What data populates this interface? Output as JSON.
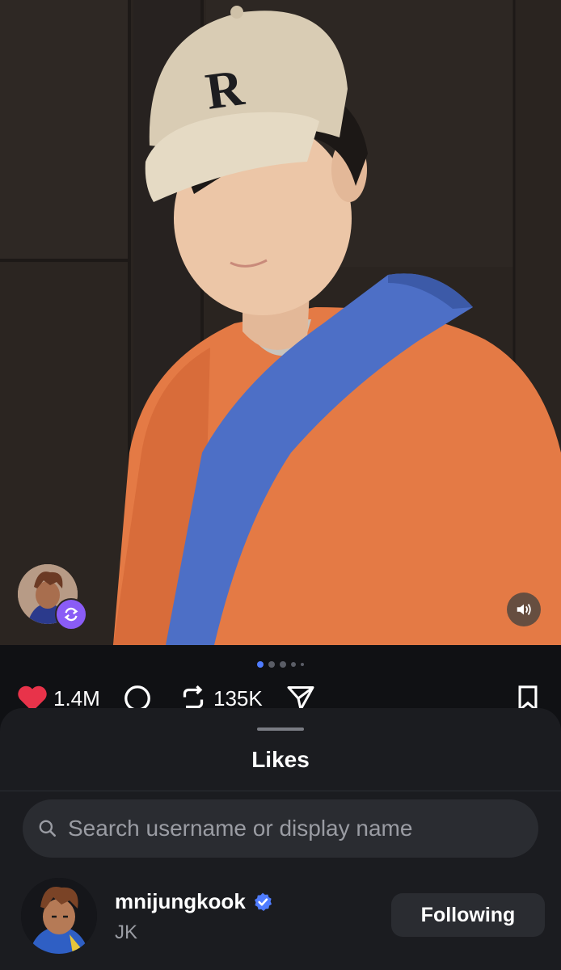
{
  "post": {
    "carousel": {
      "total": 5,
      "active_index": 0
    },
    "actions": {
      "like_count": "1.4M",
      "repost_count": "135K"
    }
  },
  "likes_sheet": {
    "title": "Likes",
    "search": {
      "placeholder": "Search username or display name",
      "value": ""
    },
    "users": [
      {
        "username": "mnijungkook",
        "display_name": "JK",
        "verified": true,
        "button_label": "Following"
      }
    ]
  },
  "colors": {
    "background": "#101114",
    "sheet": "#1b1c20",
    "accent": "#4f7cff",
    "like": "#e8334a",
    "repost_badge": "#8a5cf6"
  },
  "icons": [
    "heart-icon",
    "comment-icon",
    "repost-icon",
    "share-icon",
    "bookmark-icon",
    "search-icon",
    "verified-icon",
    "speaker-icon"
  ]
}
